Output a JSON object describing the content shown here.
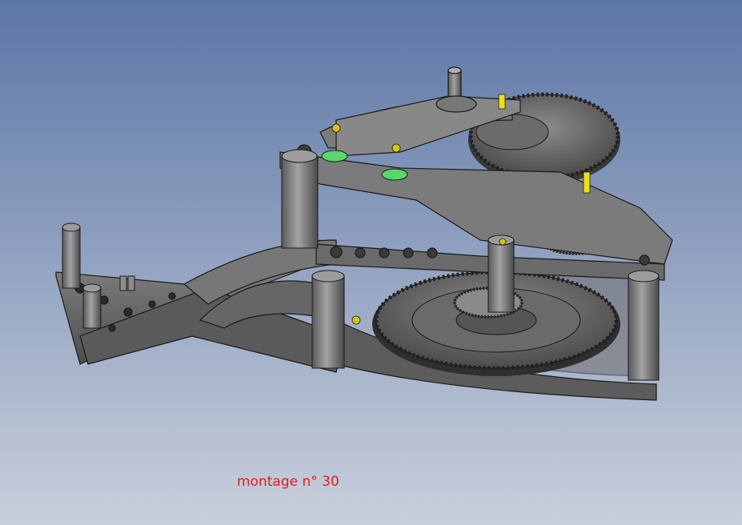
{
  "caption": {
    "text": "montage n° 30",
    "color": "#e51c1c"
  },
  "model": {
    "icon": "clock-movement-3d-model",
    "body_color": "#6b6b6b",
    "edge_color": "#1a1a1a",
    "spacer_color": "#58d66a",
    "pin_color": "#e8e01a"
  },
  "background": {
    "top_color": "#5c76a6",
    "bottom_color": "#c9d0dc"
  }
}
